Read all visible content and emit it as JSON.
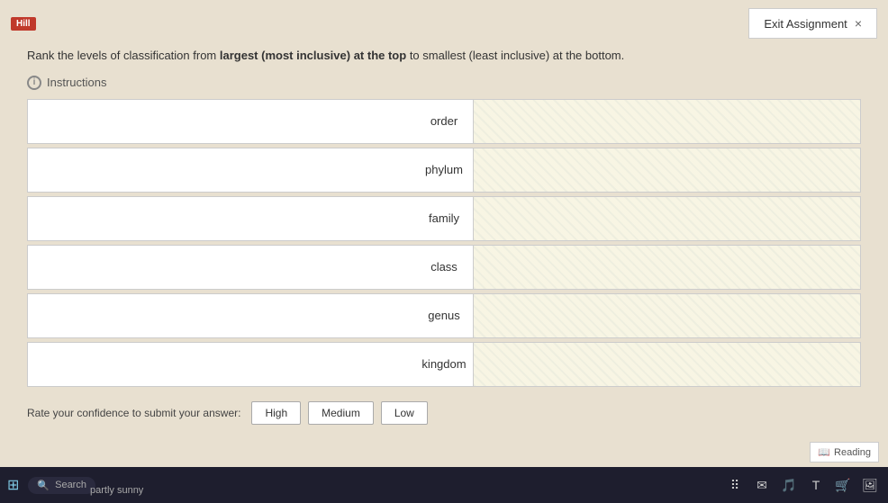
{
  "header": {
    "hill_label": "Hill",
    "exit_button_label": "Exit Assignment",
    "close_symbol": "×"
  },
  "instruction": {
    "text_prefix": "Rank the levels of classification from ",
    "text_bold": "largest (most inclusive) at the top",
    "text_suffix": " to smallest (least inclusive) at the bottom.",
    "instructions_link": "Instructions"
  },
  "rows": [
    {
      "label": "order",
      "id": "row-order"
    },
    {
      "label": "phylum",
      "id": "row-phylum"
    },
    {
      "label": "family",
      "id": "row-family"
    },
    {
      "label": "class",
      "id": "row-class"
    },
    {
      "label": "genus",
      "id": "row-genus"
    },
    {
      "label": "kingdom",
      "id": "row-kingdom"
    }
  ],
  "confidence": {
    "label": "Rate your confidence to submit your answer:",
    "buttons": [
      "High",
      "Medium",
      "Low"
    ]
  },
  "reading_badge": "Reading",
  "taskbar": {
    "search_placeholder": "Search",
    "weather_label": "partly sunny"
  }
}
